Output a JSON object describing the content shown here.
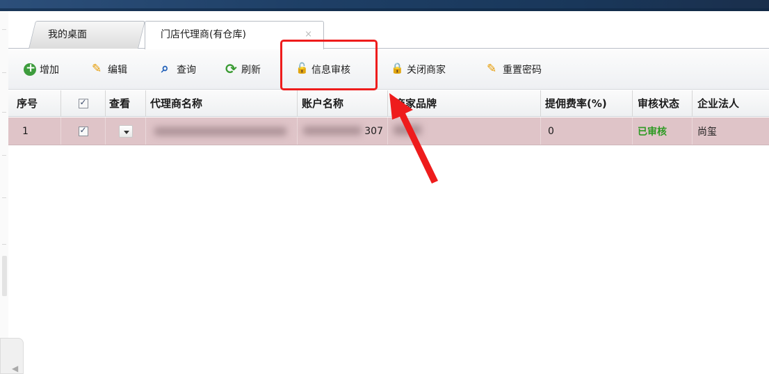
{
  "tabs": [
    {
      "label": "我的桌面",
      "active": false
    },
    {
      "label": "门店代理商(有仓库)",
      "active": true,
      "close": "×"
    }
  ],
  "toolbar": {
    "add": "增加",
    "edit": "编辑",
    "search": "查询",
    "refresh": "刷新",
    "audit": "信息审核",
    "close_merchant": "关闭商家",
    "reset_password": "重置密码"
  },
  "grid": {
    "columns": [
      "序号",
      "查看",
      "代理商名称",
      "账户名称",
      "商家品牌",
      "提佣费率(%)",
      "审核状态",
      "企业法人"
    ],
    "rows": [
      {
        "index": "1",
        "checked": true,
        "agent_name": "",
        "account_suffix": "307",
        "brand": "",
        "commission_rate": "0",
        "status": "已审核",
        "legal_person": "尚玺"
      }
    ]
  },
  "colors": {
    "highlight": "#ee1c1c",
    "row_selected": "#dfc4c8",
    "status_ok": "#2e9a24"
  }
}
